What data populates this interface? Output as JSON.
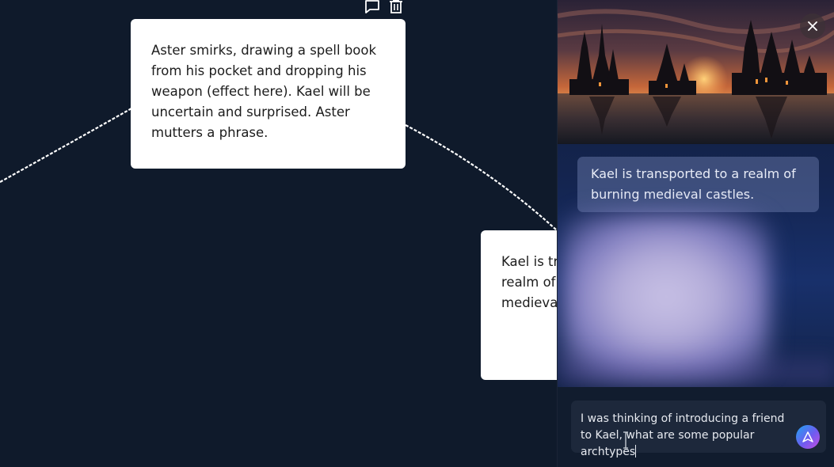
{
  "canvas": {
    "cards": [
      {
        "text": "Aster smirks, drawing a spell book from his pocket and dropping his weapon (effect here). Kael will be uncertain and surprised. Aster mutters a phrase."
      },
      {
        "text": "Kael is transported to a realm of burning medieval castles."
      }
    ],
    "card_tools": {
      "comment_icon": "comment-icon",
      "delete_icon": "trash-icon"
    }
  },
  "panel": {
    "close_icon": "close-icon",
    "image_subject": "scene-image",
    "message": "Kael is transported to a realm of burning medieval castles.",
    "input": {
      "value": "I was thinking of introducing a friend to Kael, what are some popular archtypes"
    },
    "send_icon": "send-icon"
  },
  "colors": {
    "canvas_bg": "#0f1a2b",
    "card_bg": "#ffffff",
    "panel_accent": "#18306b",
    "send_gradient_start": "#1ea4f0",
    "send_gradient_end": "#c64fe0"
  }
}
